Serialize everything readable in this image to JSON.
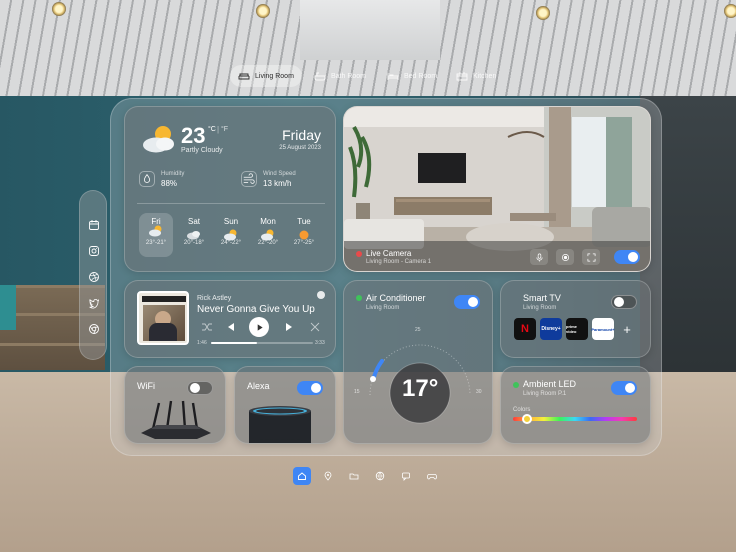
{
  "room_tabs": [
    {
      "label": "Living Room",
      "icon": "sofa-icon",
      "active": true
    },
    {
      "label": "Bath Room",
      "icon": "bathtub-icon",
      "active": false
    },
    {
      "label": "Bed Room",
      "icon": "bed-icon",
      "active": false
    },
    {
      "label": "Kitchen",
      "icon": "kitchen-icon",
      "active": false
    }
  ],
  "side_icons": [
    "calendar-icon",
    "instagram-icon",
    "dribbble-icon",
    "twitter-icon",
    "chrome-icon"
  ],
  "weather": {
    "temp": "23",
    "unit_c": "°C",
    "unit_f": "°F",
    "separator": "|",
    "condition": "Partly Cloudy",
    "day": "Friday",
    "date": "25 August 2023",
    "humidity_label": "Humidity",
    "humidity_value": "88%",
    "wind_label": "Wind Speed",
    "wind_value": "13 km/h",
    "forecast": [
      {
        "day": "Fri",
        "temps": "23°-21°",
        "icon": "partly-cloudy-icon"
      },
      {
        "day": "Sat",
        "temps": "20°-18°",
        "icon": "cloudy-icon"
      },
      {
        "day": "Sun",
        "temps": "24°-22°",
        "icon": "partly-cloudy-icon"
      },
      {
        "day": "Mon",
        "temps": "22°-20°",
        "icon": "partly-cloudy-icon"
      },
      {
        "day": "Tue",
        "temps": "27°-25°",
        "icon": "sunny-icon"
      }
    ]
  },
  "camera": {
    "title": "Live Camera",
    "subtitle": "Living Room - Camera 1",
    "status_color": "#e84a4a"
  },
  "music": {
    "artist": "Rick Astley",
    "title": "Never Gonna Give You Up",
    "elapsed": "1:46",
    "total": "3:33",
    "progress": 0.45
  },
  "ac": {
    "title": "Air Conditioner",
    "subtitle": "Living Room",
    "temp": "17°",
    "scale_min": "15",
    "scale_mid": "25",
    "scale_max": "30",
    "on": true,
    "status_color": "#3fc35a"
  },
  "tv": {
    "title": "Smart TV",
    "subtitle": "Living Room",
    "on": false,
    "apps": [
      "N",
      "Disney+",
      "prime video",
      "Paramount+"
    ],
    "add": "+"
  },
  "wifi": {
    "title": "WiFi",
    "on": false
  },
  "alexa": {
    "title": "Alexa",
    "on": true
  },
  "led": {
    "title": "Ambient LED",
    "subtitle": "Living Room P.1",
    "colors_label": "Colors",
    "on": true,
    "status_color": "#3fc35a",
    "hue_position": 0.11
  },
  "bottom_nav": [
    "home-icon",
    "location-icon",
    "folder-icon",
    "globe-icon",
    "message-icon",
    "gamepad-icon"
  ],
  "accent": "#3f86f5"
}
